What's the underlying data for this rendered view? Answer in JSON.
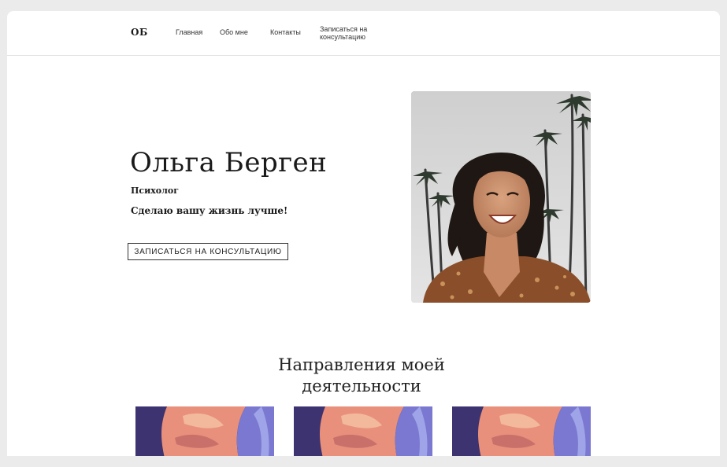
{
  "header": {
    "logo": "ОБ",
    "nav": [
      "Главная",
      "Обо мне",
      "Контакты",
      "Записаться на консультацию"
    ]
  },
  "hero": {
    "name": "Ольга Берген",
    "role": "Психолог",
    "tagline": "Сделаю вашу жизнь лучше!",
    "cta_label": "ЗАПИСАТЬСЯ НА КОНСУЛЬТАЦИЮ"
  },
  "services": {
    "title_line1": "Направления моей",
    "title_line2": "деятельности"
  },
  "colors": {
    "background": "#ebebeb",
    "page": "#ffffff",
    "text": "#1a1a1a"
  }
}
